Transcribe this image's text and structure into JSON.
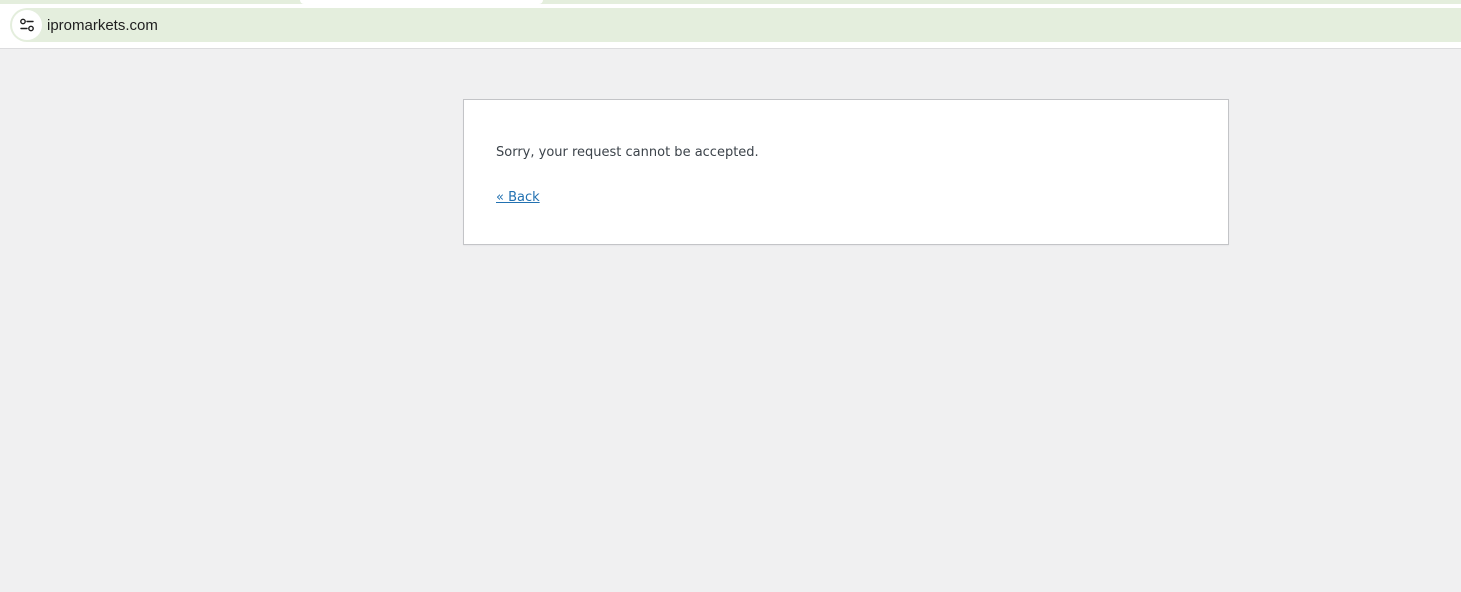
{
  "browser": {
    "url": "ipromarkets.com",
    "site_info_icon": "tune-icon",
    "address_bar_color": "#e4eedd"
  },
  "page": {
    "error_message": "Sorry, your request cannot be accepted.",
    "back_link_label": "« Back",
    "link_color": "#2271b1",
    "background_color": "#f0f0f1"
  }
}
